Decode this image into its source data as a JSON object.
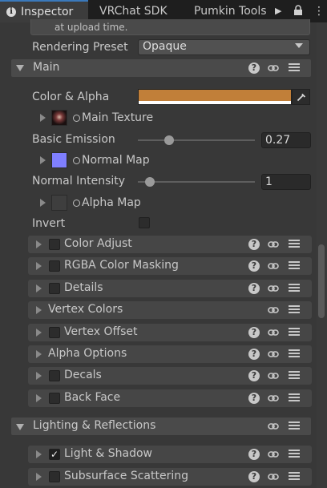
{
  "tabs": {
    "inspector": "Inspector",
    "vrchat": "VRChat SDK",
    "pumkin": "Pumkin Tools"
  },
  "help_text": "at upload time.",
  "rendering_preset": {
    "label": "Rendering Preset",
    "value": "Opaque"
  },
  "main_section": {
    "title": "Main",
    "color_alpha": {
      "label": "Color & Alpha",
      "color": "#c17f39"
    },
    "main_texture": "Main Texture",
    "basic_emission": {
      "label": "Basic Emission",
      "value": "0.27",
      "fraction": 0.27
    },
    "normal_map": "Normal Map",
    "normal_intensity": {
      "label": "Normal Intensity",
      "value": "1",
      "fraction": 0.1
    },
    "alpha_map": "Alpha Map",
    "invert": "Invert"
  },
  "subpanels": [
    {
      "label": "Color Adjust",
      "checkbox": true,
      "checked": false,
      "help": true
    },
    {
      "label": "RGBA Color Masking",
      "checkbox": true,
      "checked": false,
      "help": true
    },
    {
      "label": "Details",
      "checkbox": true,
      "checked": false,
      "help": true
    },
    {
      "label": "Vertex Colors",
      "checkbox": false,
      "checked": false,
      "help": false
    },
    {
      "label": "Vertex Offset",
      "checkbox": true,
      "checked": false,
      "help": true
    },
    {
      "label": "Alpha Options",
      "checkbox": false,
      "checked": false,
      "help": true
    },
    {
      "label": "Decals",
      "checkbox": true,
      "checked": false,
      "help": true
    },
    {
      "label": "Back Face",
      "checkbox": true,
      "checked": false,
      "help": true
    }
  ],
  "lighting_section": {
    "title": "Lighting & Reflections"
  },
  "lighting_subpanels": [
    {
      "label": "Light & Shadow",
      "checkbox": true,
      "checked": true,
      "help": true
    },
    {
      "label": "Subsurface Scattering",
      "checkbox": true,
      "checked": false,
      "help": true
    }
  ],
  "colors": {
    "accent": "#3a79bb",
    "normal_map_swatch": "#7f7fff"
  }
}
